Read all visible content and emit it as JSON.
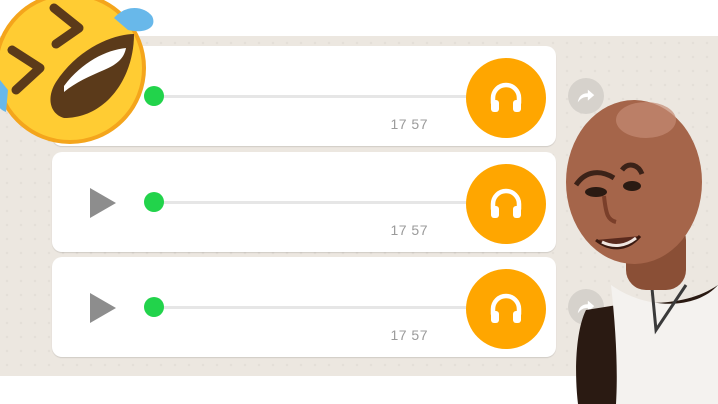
{
  "messages": [
    {
      "time": "17 57",
      "progress": 0.0,
      "has_play_icon": false
    },
    {
      "time": "17 57",
      "progress": 0.0,
      "has_play_icon": true
    },
    {
      "time": "17 57",
      "progress": 0.0,
      "has_play_icon": true
    }
  ],
  "icons": {
    "play": "play-icon",
    "headphones": "headphones-icon",
    "forward": "forward-icon",
    "emoji": "laughing-tears-emoji-icon"
  },
  "colors": {
    "chat_background": "#ece7e0",
    "bubble": "#ffffff",
    "progress_knob": "#22d34b",
    "avatar": "#ffa600",
    "play": "#8d8d8d",
    "timestamp": "#9b9b9b"
  }
}
